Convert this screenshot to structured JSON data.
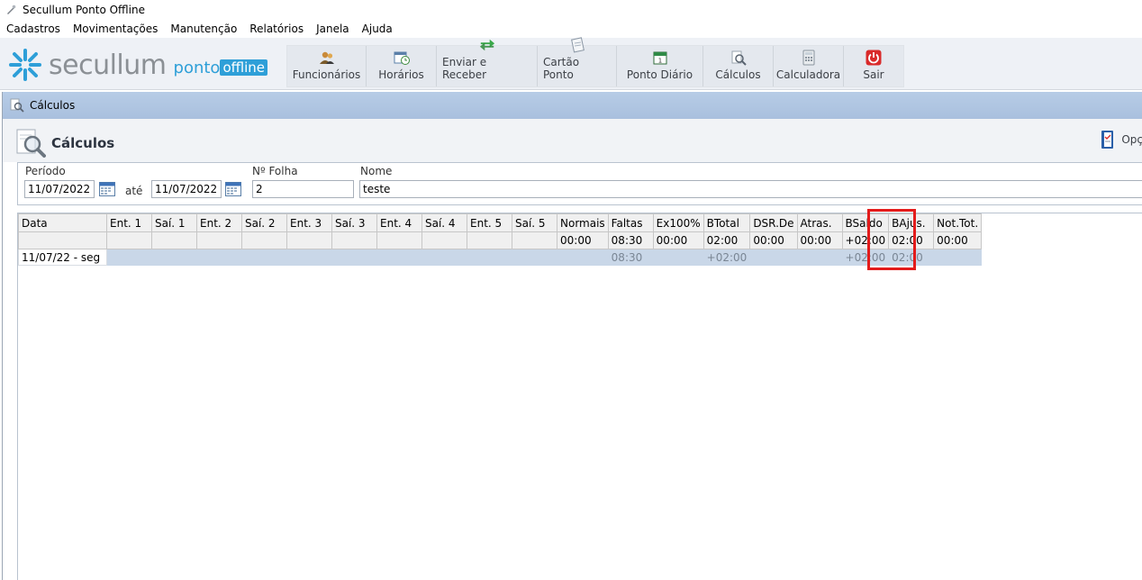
{
  "window_title": "Secullum Ponto Offline",
  "menu": [
    "Cadastros",
    "Movimentações",
    "Manutenção",
    "Relatórios",
    "Janela",
    "Ajuda"
  ],
  "logo": {
    "brand": "secullum",
    "ponto": "ponto",
    "offline": "offline"
  },
  "toolbar": [
    {
      "label": "Funcionários",
      "icon": "users-icon"
    },
    {
      "label": "Horários",
      "icon": "schedule-icon"
    },
    {
      "label": "Enviar e Receber",
      "icon": "sync-arrows-icon"
    },
    {
      "label": "Cartão Ponto",
      "icon": "time-card-icon"
    },
    {
      "label": "Ponto Diário",
      "icon": "calendar-day-icon"
    },
    {
      "label": "Cálculos",
      "icon": "calculations-icon"
    },
    {
      "label": "Calculadora",
      "icon": "calculator-icon"
    },
    {
      "label": "Sair",
      "icon": "power-icon"
    }
  ],
  "child_window": {
    "title": "Cálculos",
    "heading": "Cálculos",
    "options_label": "Opç"
  },
  "filters": {
    "periodo_label": "Período",
    "periodo_start": "11/07/2022",
    "ate_label": "até",
    "periodo_end": "11/07/2022",
    "folha_label": "Nº Folha",
    "folha_value": "2",
    "nome_label": "Nome",
    "nome_value": "teste"
  },
  "grid": {
    "columns": [
      "Data",
      "Ent. 1",
      "Saí. 1",
      "Ent. 2",
      "Saí. 2",
      "Ent. 3",
      "Saí. 3",
      "Ent. 4",
      "Saí. 4",
      "Ent. 5",
      "Saí. 5",
      "Normais",
      "Faltas",
      "Ex100%",
      "BTotal",
      "DSR.De",
      "Atras.",
      "BSaldo",
      "BAjus.",
      "Not.Tot."
    ],
    "totals": [
      "",
      "",
      "",
      "",
      "",
      "",
      "",
      "",
      "",
      "",
      "",
      "00:00",
      "08:30",
      "00:00",
      "02:00",
      "00:00",
      "00:00",
      "+02:00",
      "02:00",
      "00:00"
    ],
    "rows": [
      [
        "11/07/22 - seg",
        "",
        "",
        "",
        "",
        "",
        "",
        "",
        "",
        "",
        "",
        "",
        "08:30",
        "",
        "+02:00",
        "",
        "",
        "+02:00",
        "02:00",
        ""
      ]
    ]
  },
  "colors": {
    "accent": "#2e9fd8",
    "highlight": "#e31b1b",
    "row_selected": "#c9d7e8"
  }
}
